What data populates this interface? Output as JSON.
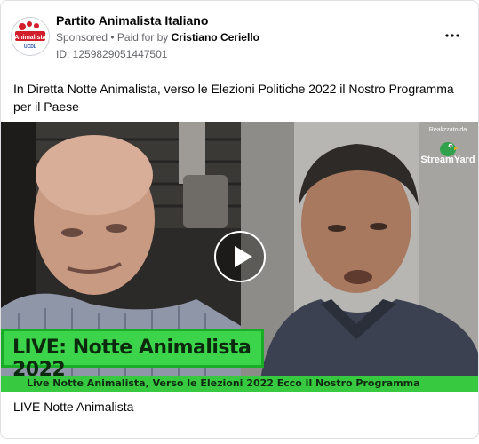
{
  "post": {
    "page_name": "Partito Animalista Italiano",
    "sponsored": "Sponsored",
    "separator": " • ",
    "paid_for_prefix": "Paid for by ",
    "paid_for_name": "Cristiano Ceriello",
    "ad_id": "ID: 1259829051447501",
    "text": "In Diretta Notte Animalista, verso le Elezioni Politiche 2022 il Nostro Programma per il Paese",
    "more_icon": "more-horizontal-icon"
  },
  "video": {
    "banner": "LIVE: Notte Animalista 2022",
    "ticker": "Live Notte Animalista, Verso le Elezioni 2022 Ecco il Nostro Programma",
    "brand_small": "Realizzato da",
    "brand_name": "StreamYard",
    "play_icon": "play-icon"
  },
  "caption": "LIVE Notte Animalista",
  "logo_text": [
    "Partito",
    "Animalista",
    "Italiano"
  ]
}
